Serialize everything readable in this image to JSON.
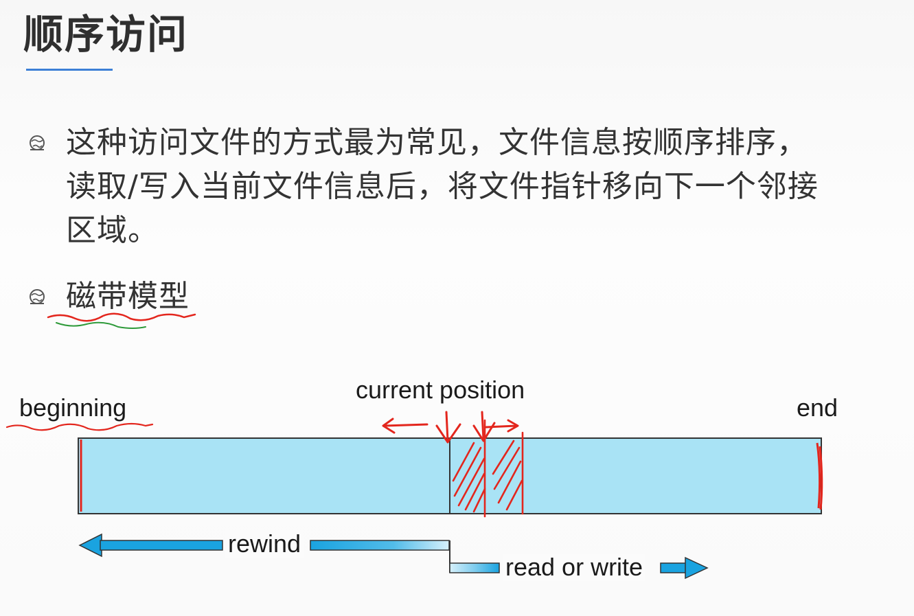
{
  "slide": {
    "title": "顺序访问",
    "bullets": [
      {
        "icon": "globe-bullet-icon",
        "lines": [
          "这种访问文件的方式最为常见，文件信息按顺序排序，",
          "读取/写入当前文件信息后，将文件指针移向下一个邻接",
          "区域。"
        ]
      },
      {
        "icon": "globe-bullet-icon",
        "text": "磁带模型"
      }
    ]
  },
  "diagram": {
    "labels": {
      "beginning": "beginning",
      "current_position": "current position",
      "end": "end",
      "rewind": "rewind",
      "read_or_write": "read or write"
    },
    "colors": {
      "tape_fill": "#a9e3f5",
      "tape_border": "#333333",
      "arrow_blue": "#1aa3e0",
      "annotation_red": "#e3261d",
      "annotation_green": "#2e9a3a",
      "title_underline": "#3c7fd6"
    }
  }
}
